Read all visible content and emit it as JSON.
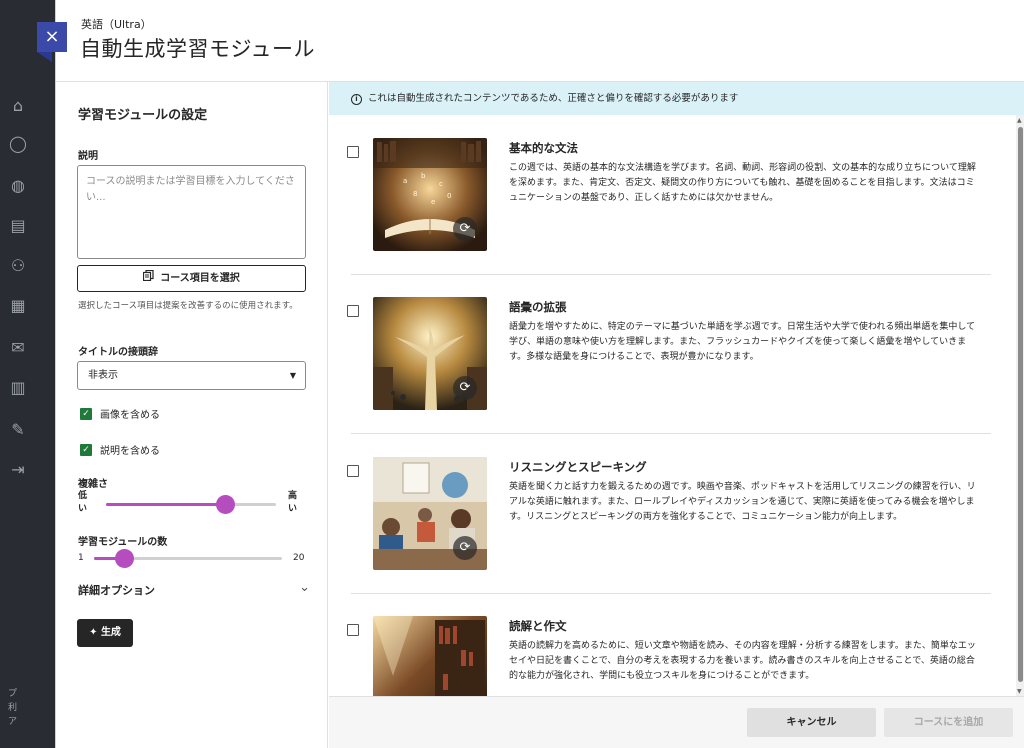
{
  "background": {
    "footer_lines": [
      "プ",
      "利",
      "ア"
    ]
  },
  "modal": {
    "subtitle": "英語（Ultra）",
    "title": "自動生成学習モジュール",
    "close_icon": "×"
  },
  "settings": {
    "heading": "学習モジュールの設定",
    "description_label": "説明",
    "description_placeholder": "コースの説明または学習目標を入力してください...",
    "select_course_items_label": "コース項目を選択",
    "helper_text": "選択したコース項目は提案を改善するのに使用されます。",
    "title_prefix_label": "タイトルの接頭辞",
    "title_prefix_value": "非表示",
    "include_images_label": "画像を含める",
    "include_images_checked": true,
    "include_descriptions_label": "説明を含める",
    "include_descriptions_checked": true,
    "complexity_label": "複雑さ",
    "complexity_low": "低い",
    "complexity_high": "高い",
    "complexity_level": 0.7,
    "module_count_label": "学習モジュールの数",
    "module_count_min": "1",
    "module_count_max": "20",
    "module_count_value": 4,
    "advanced_options_label": "詳細オプション",
    "generate_label": "生成"
  },
  "info_banner": "これは自動生成されたコンテンツであるため、正確さと偏りを確認する必要があります",
  "modules": [
    {
      "title": "基本的な文法",
      "description": "この週では、英語の基本的な文法構造を学びます。名詞、動詞、形容詞の役割、文の基本的な成り立ちについて理解を深めます。また、肯定文、否定文、疑問文の作り方についても触れ、基礎を固めることを目指します。文法はコミュニケーションの基盤であり、正しく話すためには欠かせません。"
    },
    {
      "title": "語彙の拡張",
      "description": "語彙力を増やすために、特定のテーマに基づいた単語を学ぶ週です。日常生活や大学で使われる頻出単語を集中して学び、単語の意味や使い方を理解します。また、フラッシュカードやクイズを使って楽しく語彙を増やしていきます。多様な語彙を身につけることで、表現が豊かになります。"
    },
    {
      "title": "リスニングとスピーキング",
      "description": "英語を聞く力と話す力を鍛えるための週です。映画や音楽、ポッドキャストを活用してリスニングの練習を行い、リアルな英語に触れます。また、ロールプレイやディスカッションを通じて、実際に英語を使ってみる機会を増やします。リスニングとスピーキングの両方を強化することで、コミュニケーション能力が向上します。"
    },
    {
      "title": "読解と作文",
      "description": "英語の読解力を高めるために、短い文章や物語を読み、その内容を理解・分析する練習をします。また、簡単なエッセイや日記を書くことで、自分の考えを表現する力を養います。読み書きのスキルを向上させることで、英語の総合的な能力が強化され、学問にも役立つスキルを身につけることができます。"
    }
  ],
  "footer": {
    "cancel_label": "キャンセル",
    "add_label": "コースにを追加"
  },
  "colors": {
    "accent_purple": "#b64dbf",
    "close_button": "#3b4aa8",
    "check_green": "#1f7a3a",
    "info_banner": "#d9f1f7"
  },
  "icons": {
    "info": "info-icon",
    "course_items": "document-stack-icon",
    "dropdown": "caret-down-icon",
    "advanced": "chevron-down-icon",
    "generate": "sparkle-icon",
    "regenerate": "refresh-icon"
  }
}
